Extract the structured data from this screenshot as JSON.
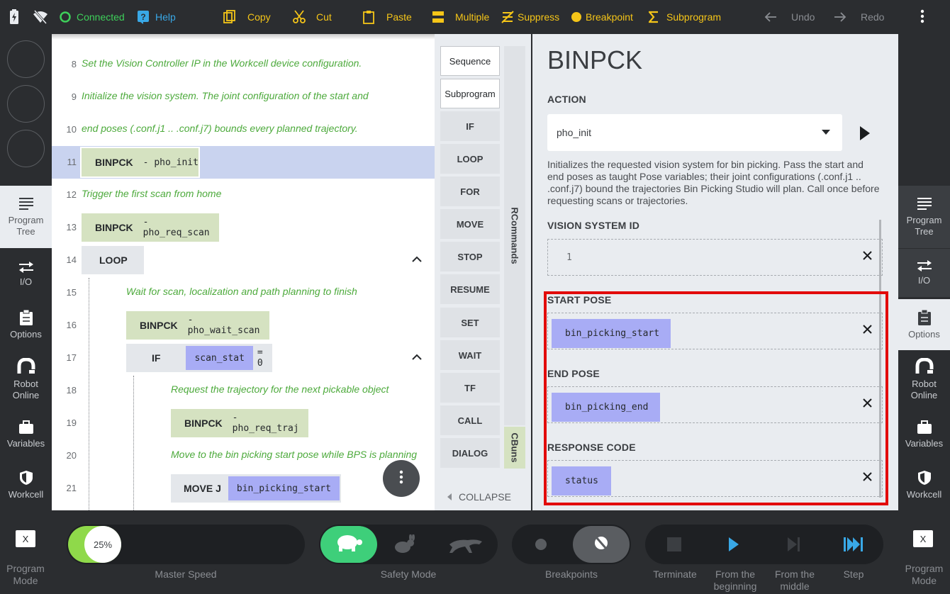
{
  "topbar": {
    "connected": "Connected",
    "help": "Help",
    "copy": "Copy",
    "cut": "Cut",
    "paste": "Paste",
    "multiple": "Multiple",
    "suppress": "Suppress",
    "breakpoint": "Breakpoint",
    "subprogram": "Subprogram",
    "undo": "Undo",
    "redo": "Redo"
  },
  "left_nav": {
    "program_tree": "Program Tree",
    "io": "I/O",
    "options": "Options",
    "robot_online": "Robot Online",
    "variables": "Variables",
    "workcell": "Workcell"
  },
  "right_nav": {
    "program_tree": "Program Tree",
    "io": "I/O",
    "options": "Options",
    "robot_online": "Robot Online",
    "variables": "Variables",
    "workcell": "Workcell"
  },
  "program": {
    "lines": [
      {
        "num": "8",
        "text": "Set the Vision Controller IP in the Workcell device configuration."
      },
      {
        "num": "9",
        "text": "Initialize the vision system. The joint configuration of the start and"
      },
      {
        "num": "10",
        "text": "end poses (.conf.j1 .. .conf.j7) bounds every planned trajectory."
      },
      {
        "num": "11",
        "kw": "BINPCK",
        "arg": "- pho_init"
      },
      {
        "num": "12",
        "text": "Trigger the first scan from home"
      },
      {
        "num": "13",
        "kw": "BINPCK",
        "arg": "- pho_req_scan"
      },
      {
        "num": "14",
        "kw": "LOOP"
      },
      {
        "num": "15",
        "text": "Wait for scan, localization and path planning to finish"
      },
      {
        "num": "16",
        "kw": "BINPCK",
        "arg": "- pho_wait_scan"
      },
      {
        "num": "17",
        "kw": "IF",
        "var": "scan_stat",
        "rest": "= 0"
      },
      {
        "num": "18",
        "text": "Request the trajectory for the next pickable object"
      },
      {
        "num": "19",
        "kw": "BINPCK",
        "arg": "- pho_req_traj"
      },
      {
        "num": "20",
        "text": "Move to the bin picking start pose while BPS is planning"
      },
      {
        "num": "21",
        "kw": "MOVE J",
        "var": "bin_picking_start"
      }
    ]
  },
  "commands": {
    "buttons": [
      "Sequence",
      "Subprogram",
      "IF",
      "LOOP",
      "FOR",
      "MOVE",
      "STOP",
      "RESUME",
      "SET",
      "WAIT",
      "TF",
      "CALL",
      "DIALOG"
    ],
    "tab_rcommands": "RCommands",
    "tab_cbuns": "CBuns",
    "collapse": "COLLAPSE"
  },
  "detail": {
    "title": "BINPCK",
    "action_label": "ACTION",
    "action_value": "pho_init",
    "description": "Initializes the requested vision system for bin picking. Pass the start and end poses as taught Pose variables; their joint configurations (.conf.j1 .. .conf.j7) bound the trajectories Bin Picking Studio will plan. Call once before requesting scans or trajectories.",
    "vision_label": "VISION SYSTEM ID",
    "vision_value": "1",
    "start_label": "START POSE",
    "start_value": "bin_picking_start",
    "end_label": "END POSE",
    "end_value": "bin_picking_end",
    "response_label": "RESPONSE CODE",
    "response_value": "status"
  },
  "bottom": {
    "program_mode_left": "Program Mode",
    "program_mode_right": "Program Mode",
    "x_left": "X",
    "x_right": "X",
    "speed_value": "25%",
    "speed_fraction": 0.25,
    "master_speed": "Master Speed",
    "safety_mode": "Safety Mode",
    "breakpoints": "Breakpoints",
    "terminate": "Terminate",
    "from_beginning": "From the beginning",
    "from_middle": "From the middle",
    "step": "Step"
  },
  "colors": {
    "accent": "#f5c518",
    "connected": "#3ecf5a",
    "help": "#39a8e6",
    "speed_green": "#8fd94a",
    "variable": "#a8acf5",
    "binpck_block": "#d5e2c1",
    "highlight_box": "#e20b0b"
  }
}
